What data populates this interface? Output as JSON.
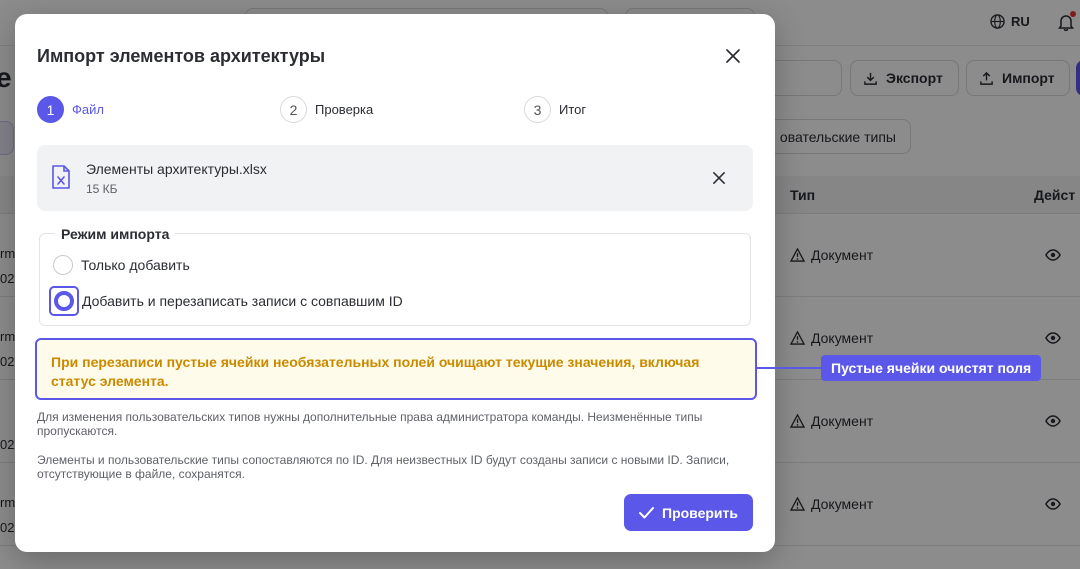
{
  "background": {
    "lang": "RU",
    "page_title_fragment": "е",
    "export_label": "Экспорт",
    "import_label": "Импорт",
    "chip_label": "овательские типы",
    "col_type": "Тип",
    "col_actions": "Дейст",
    "rows": [
      {
        "type": "Документ",
        "cut1": "rm",
        "cut2": "02"
      },
      {
        "type": "Документ",
        "cut1": "rm",
        "cut2": "02"
      },
      {
        "type": "Документ",
        "cut1": "",
        "cut2": "02"
      },
      {
        "type": "Документ",
        "cut1": "rm",
        "cut2": "02"
      }
    ]
  },
  "modal": {
    "title": "Импорт элементов архитектуры",
    "steps": [
      {
        "num": "1",
        "label": "Файл"
      },
      {
        "num": "2",
        "label": "Проверка"
      },
      {
        "num": "3",
        "label": "Итог"
      }
    ],
    "file": {
      "name": "Элементы архитектуры.xlsx",
      "size": "15 КБ"
    },
    "mode": {
      "legend": "Режим импорта",
      "option_add": "Только добавить",
      "option_overwrite": "Добавить и перезаписать записи с совпавшим ID",
      "selected": "overwrite"
    },
    "warning": "При перезаписи пустые ячейки необязательных полей очищают текущие значения, включая статус элемента.",
    "note1": "Для изменения пользовательских типов нужны дополнительные права администратора команды. Неизменённые типы пропускаются.",
    "note2": "Элементы и пользовательские типы сопоставляются по ID. Для неизвестных ID будут созданы записи с новыми ID. Записи, отсутствующие в файле, сохранятся.",
    "verify_label": "Проверить"
  },
  "annotation": {
    "callout": "Пустые ячейки очистят поля"
  },
  "colors": {
    "accent": "#5b57e8",
    "warning_text": "#c98a00",
    "warning_bg": "#fffbea"
  }
}
